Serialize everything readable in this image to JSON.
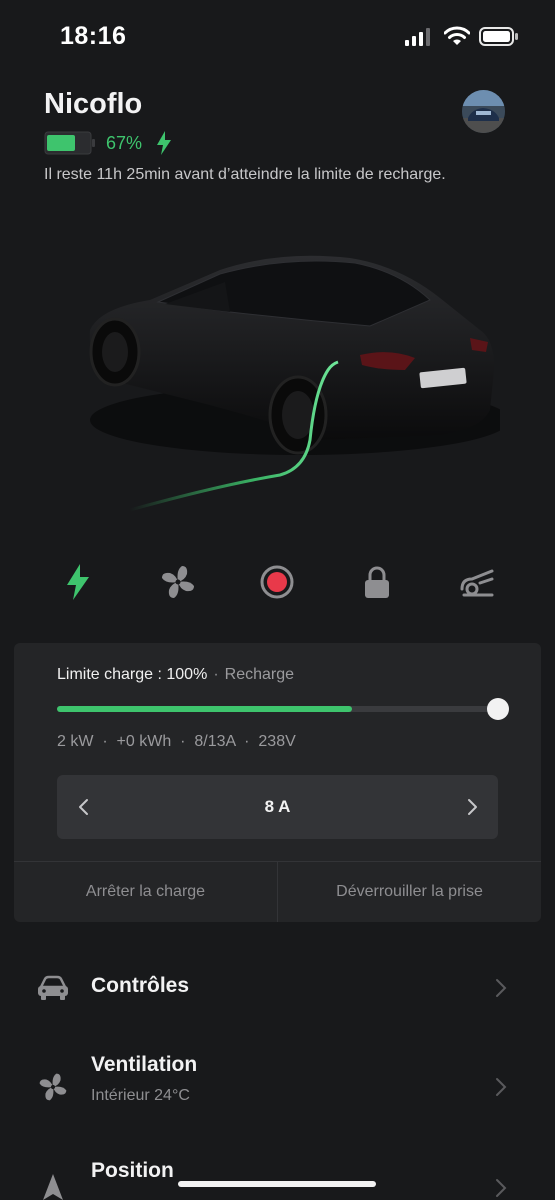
{
  "status_bar": {
    "time": "18:16"
  },
  "header": {
    "vehicle_name": "Nicoflo",
    "battery_percent": "67%",
    "battery_level": 0.67,
    "subtitle": "Il reste 11h 25min avant d’atteindre la limite de recharge."
  },
  "quick_icons": [
    "charge-bolt-icon",
    "fan-icon",
    "record-icon",
    "lock-icon",
    "charge-port-icon"
  ],
  "charge_card": {
    "limit_label": "Limite charge : 100%",
    "separator": "·",
    "state": "Recharge",
    "slider_fill": 0.67,
    "stats": "2 kW  ·  +0 kWh  ·  8/13A  ·  238V",
    "amps_value": "8 A",
    "stop_button": "Arrêter la charge",
    "unlock_button": "Déverrouiller la prise"
  },
  "menu": {
    "items": [
      {
        "title": "Contrôles",
        "subtitle": "",
        "icon": "car-icon"
      },
      {
        "title": "Ventilation",
        "subtitle": "Intérieur 24°C",
        "icon": "fan-icon"
      },
      {
        "title": "Position",
        "subtitle": "",
        "icon": "navigation-arrow-icon"
      }
    ]
  },
  "colors": {
    "accent": "#3ec46d",
    "background": "#18191b",
    "card": "#242527",
    "record": "#e8394a"
  }
}
